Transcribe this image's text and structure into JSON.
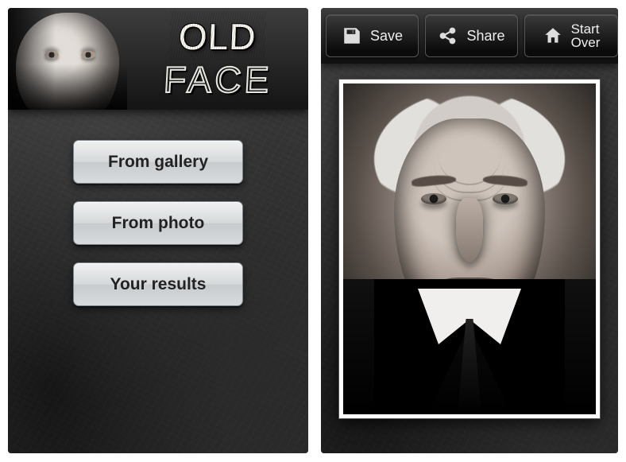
{
  "app": {
    "title_top": "OLD",
    "title_bottom": "FACE"
  },
  "home": {
    "buttons": {
      "from_gallery": "From gallery",
      "from_photo": "From photo",
      "your_results": "Your results"
    }
  },
  "result": {
    "toolbar": {
      "save": "Save",
      "share": "Share",
      "start_line1": "Start",
      "start_line2": "Over"
    },
    "icons": {
      "save": "save-icon",
      "share": "share-icon",
      "home": "home-icon"
    }
  }
}
